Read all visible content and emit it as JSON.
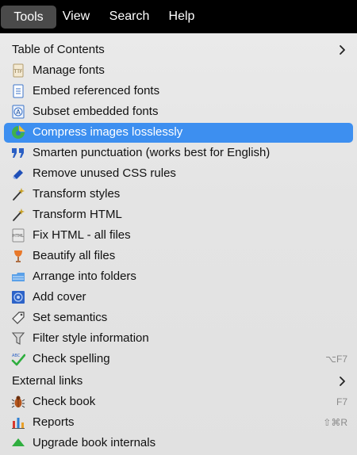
{
  "menubar": {
    "items": [
      "Tools",
      "View",
      "Search",
      "Help"
    ],
    "active": "Tools"
  },
  "menu": {
    "toc": {
      "label": "Table of Contents"
    },
    "manage_fonts": {
      "label": "Manage fonts"
    },
    "embed_fonts": {
      "label": "Embed referenced fonts"
    },
    "subset_fonts": {
      "label": "Subset embedded fonts"
    },
    "compress_images": {
      "label": "Compress images losslessly"
    },
    "smarten_punct": {
      "label": "Smarten punctuation (works best for English)"
    },
    "remove_css": {
      "label": "Remove unused CSS rules"
    },
    "transform_styles": {
      "label": "Transform styles"
    },
    "transform_html": {
      "label": "Transform HTML"
    },
    "fix_html": {
      "label": "Fix HTML - all files"
    },
    "beautify": {
      "label": "Beautify all files"
    },
    "arrange_folders": {
      "label": "Arrange into folders"
    },
    "add_cover": {
      "label": "Add cover"
    },
    "set_semantics": {
      "label": "Set semantics"
    },
    "filter_style": {
      "label": "Filter style information"
    },
    "check_spelling": {
      "label": "Check spelling",
      "shortcut": "⌥F7"
    },
    "external_links": {
      "label": "External links"
    },
    "check_book": {
      "label": "Check book",
      "shortcut": "F7"
    },
    "reports": {
      "label": "Reports",
      "shortcut": "⇧⌘R"
    },
    "upgrade": {
      "label": "Upgrade book internals"
    }
  },
  "colors": {
    "highlight": "#3d8ff0",
    "menubar_bg": "#000000",
    "menu_bg": "#e6e6e6"
  },
  "highlighted_item": "Compress images losslessly"
}
